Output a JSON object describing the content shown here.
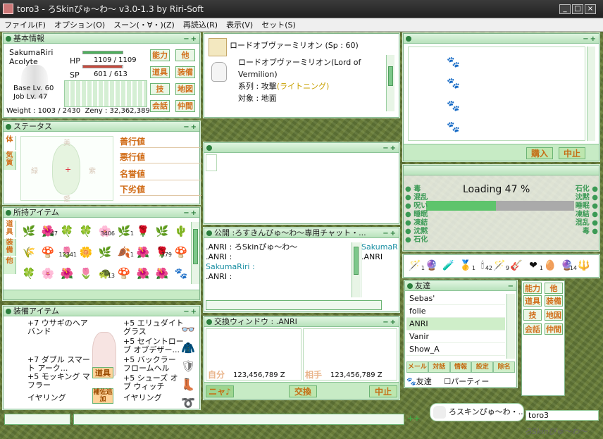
{
  "app": {
    "title": "toro3 - ろSkinぴゅ〜わ〜 v3.0-1.3 by Riri-Soft"
  },
  "menu": [
    "ファイル(F)",
    "オプション(O)",
    "スーン(・∀・)(Z)",
    "再読込(R)",
    "表示(V)",
    "セット(S)"
  ],
  "basic": {
    "title": "基本情報",
    "name": "SakumaRiri",
    "job": "Acolyte",
    "hp_label": "HP",
    "hp": "1109  /  1109",
    "sp_label": "SP",
    "sp": "601  /  613",
    "base_lv": "Base Lv. 60",
    "job_lv": "Job Lv. 47",
    "weight": "Weight : 1003 / 2430",
    "zeny": "Zeny : 32,362,389",
    "hp_pct": 100,
    "sp_pct": 98,
    "buttons": [
      "能力",
      "他",
      "道具",
      "装備",
      "技",
      "地図",
      "会話",
      "仲間"
    ]
  },
  "skill": {
    "header": "ロードオブヴァーミリオン (Sp : 60)",
    "name_line1": "ロードオブヴァーミリオン(Lord of",
    "name_line2": "Vermilion)",
    "type_label": "系列 : 攻撃",
    "type_value": "(ライトニング)",
    "target": "対象 : 地面"
  },
  "status": {
    "title": "ステータス",
    "tabs": [
      "体",
      "気質"
    ],
    "rows": [
      "善行値",
      "悪行値",
      "名誉値",
      "下劣値"
    ],
    "dirs": [
      "美",
      "紫",
      "緑",
      "愛"
    ]
  },
  "items": {
    "title": "所持アイテム",
    "tabs": [
      "道具",
      "装備",
      "他"
    ],
    "counts": [
      "",
      "47",
      "",
      "",
      "3406",
      "1",
      "",
      "",
      "",
      "",
      "",
      "12341",
      "",
      "",
      "1",
      "",
      "379",
      "",
      "",
      "",
      "",
      "",
      "13",
      "",
      "",
      "",
      "",
      "",
      ""
    ]
  },
  "equip": {
    "title": "装備アイテム",
    "left": [
      "+7 ウサギのヘアバンド",
      "",
      "+7 ダブル スマート アーク...",
      "+5 モッキング マフラー",
      "イヤリング"
    ],
    "right": [
      "+5 エリュダイトグラス",
      "+5 セイントローブ オブデザー...",
      "+5 バックラー フロームヘル",
      "+5 シューズ オブ ウィッチ",
      "イヤリング"
    ],
    "btn_items": "道具",
    "btn_auto": "補佐追加"
  },
  "chat": {
    "title": "公開 :ろすきんぴゅ〜わ〜専用チャット・...",
    "lines": [
      ".ANRI : ろSkinぴゅ〜わ〜",
      ".ANRI :",
      "SakumaRiri :",
      ".ANRI :"
    ],
    "members": [
      "SakumaRiri",
      ".ANRI"
    ]
  },
  "trade": {
    "title": "交換ウィンドウ : .ANRI",
    "my_label": "自分",
    "partner_label": "相手",
    "my_zeny": "123,456,789 Z",
    "partner_zeny": "123,456,789 Z",
    "btn_nya": "ニャ♪",
    "btn_exchange": "交換",
    "btn_cancel": "中止"
  },
  "shop": {
    "btn_buy": "購入",
    "btn_cancel": "中止"
  },
  "loading": {
    "text": "Loading 47 %",
    "pct": 47,
    "left": [
      "毒",
      "混乱",
      "呪い",
      "睡眠",
      "凍結",
      "沈黙",
      "石化"
    ],
    "right": [
      "石化",
      "沈黙",
      "睡眠",
      "凍結",
      "混乱",
      "毒"
    ]
  },
  "hotbar": {
    "counts": [
      "1",
      "",
      "",
      "1",
      "42",
      "9",
      "",
      "1",
      "",
      "14",
      ""
    ]
  },
  "friends": {
    "title": "友達",
    "list": [
      "Sebas'",
      "folie",
      "ANRI",
      "Vanir",
      "Show_A"
    ],
    "tabs": [
      "メール",
      "対話",
      "情報",
      "設定",
      "除名"
    ],
    "tab_friend": "友達",
    "tab_party": "パーティー",
    "buttons": [
      "能力",
      "他",
      "道具",
      "装備",
      "技",
      "地図",
      "会話",
      "仲間"
    ]
  },
  "bottom": {
    "bubble": "ろスキンぴゅ〜わ・..",
    "name": "toro3",
    "logo": "ろSkinぴゅ〜わ〜"
  }
}
